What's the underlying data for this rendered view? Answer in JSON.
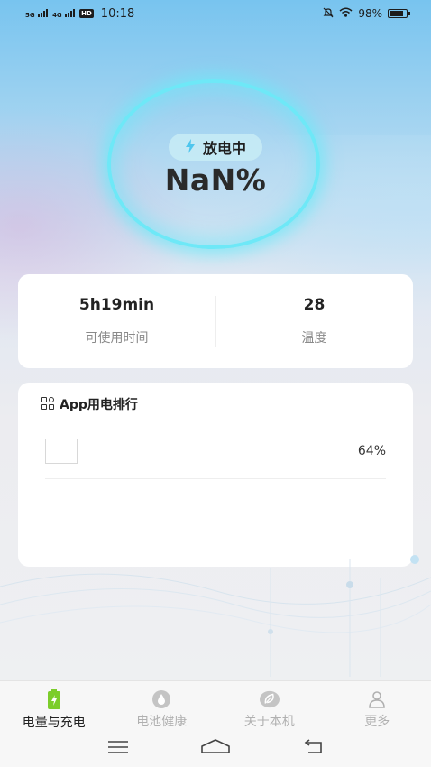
{
  "status_bar": {
    "network1": "5G",
    "network2": "4G",
    "hd": "HD",
    "time": "10:18",
    "battery_text": "98%"
  },
  "battery": {
    "state": "放电中",
    "percent": "NaN%"
  },
  "stats": {
    "usage_time": {
      "value": "5h19min",
      "label": "可使用时间"
    },
    "temperature": {
      "value": "28",
      "label": "温度"
    }
  },
  "app_ranking": {
    "title": "App用电排行",
    "items": [
      {
        "name": "",
        "percent": "64%"
      }
    ]
  },
  "bottom_nav": {
    "tabs": [
      {
        "label": "电量与充电",
        "icon": "battery-charging-icon",
        "active": true
      },
      {
        "label": "电池健康",
        "icon": "water-drop-icon",
        "active": false
      },
      {
        "label": "关于本机",
        "icon": "leaf-icon",
        "active": false
      },
      {
        "label": "更多",
        "icon": "person-icon",
        "active": false
      }
    ]
  },
  "colors": {
    "ring": "#6ee8f7",
    "active_icon": "#7ccd2b",
    "inactive": "#b0b0b0"
  }
}
